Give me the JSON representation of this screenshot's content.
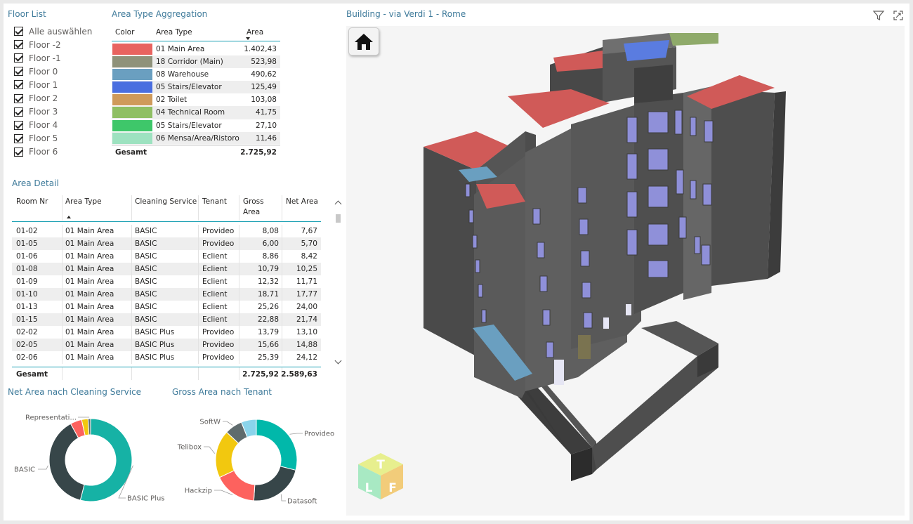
{
  "floor_list": {
    "title": "Floor List",
    "items": [
      {
        "label": "Alle auswählen",
        "checked": true
      },
      {
        "label": "Floor -2",
        "checked": true
      },
      {
        "label": "Floor -1",
        "checked": true
      },
      {
        "label": "Floor 0",
        "checked": true
      },
      {
        "label": "Floor 1",
        "checked": true
      },
      {
        "label": "Floor 2",
        "checked": true
      },
      {
        "label": "Floor 3",
        "checked": true
      },
      {
        "label": "Floor 4",
        "checked": true
      },
      {
        "label": "Floor 5",
        "checked": true
      },
      {
        "label": "Floor 6",
        "checked": true
      }
    ]
  },
  "area_type_aggregation": {
    "title": "Area Type Aggregation",
    "headers": {
      "color": "Color",
      "area_type": "Area Type",
      "area": "Area"
    },
    "rows": [
      {
        "color": "#e8635f",
        "type": "01 Main Area",
        "area": "1.402,43"
      },
      {
        "color": "#8f927a",
        "type": "18 Corridor (Main)",
        "area": "523,98"
      },
      {
        "color": "#6a9fc0",
        "type": "08 Warehouse",
        "area": "490,62"
      },
      {
        "color": "#4a6ee0",
        "type": "05 Stairs/Elevator",
        "area": "125,49"
      },
      {
        "color": "#cf9a5a",
        "type": "02 Toilet",
        "area": "103,08"
      },
      {
        "color": "#8fbf63",
        "type": "04 Technical Room",
        "area": "41,75"
      },
      {
        "color": "#3ec76a",
        "type": "05 Stairs/Elevator",
        "area": "27,10"
      },
      {
        "color": "#9de2c0",
        "type": "06 Mensa/Area/Ristoro",
        "area": "11,46"
      }
    ],
    "total_label": "Gesamt",
    "total_value": "2.725,92"
  },
  "area_detail": {
    "title": "Area Detail",
    "headers": {
      "room": "Room Nr",
      "type": "Area Type",
      "cleaning": "Cleaning Service",
      "tenant": "Tenant",
      "gross": "Gross Area",
      "net": "Net Area"
    },
    "rows": [
      {
        "room": "01-02",
        "type": "01 Main Area",
        "cleaning": "BASIC",
        "tenant": "Provideo",
        "gross": "8,08",
        "net": "7,67"
      },
      {
        "room": "01-05",
        "type": "01 Main Area",
        "cleaning": "BASIC",
        "tenant": "Provideo",
        "gross": "6,00",
        "net": "5,70"
      },
      {
        "room": "01-06",
        "type": "01 Main Area",
        "cleaning": "BASIC",
        "tenant": "Eclient",
        "gross": "8,86",
        "net": "8,42"
      },
      {
        "room": "01-08",
        "type": "01 Main Area",
        "cleaning": "BASIC",
        "tenant": "Eclient",
        "gross": "10,79",
        "net": "10,25"
      },
      {
        "room": "01-09",
        "type": "01 Main Area",
        "cleaning": "BASIC",
        "tenant": "Eclient",
        "gross": "12,32",
        "net": "11,71"
      },
      {
        "room": "01-10",
        "type": "01 Main Area",
        "cleaning": "BASIC",
        "tenant": "Eclient",
        "gross": "18,71",
        "net": "17,77"
      },
      {
        "room": "01-13",
        "type": "01 Main Area",
        "cleaning": "BASIC",
        "tenant": "Eclient",
        "gross": "25,26",
        "net": "24,00"
      },
      {
        "room": "01-15",
        "type": "01 Main Area",
        "cleaning": "BASIC",
        "tenant": "Eclient",
        "gross": "22,88",
        "net": "21,74"
      },
      {
        "room": "02-02",
        "type": "01 Main Area",
        "cleaning": "BASIC Plus",
        "tenant": "Provideo",
        "gross": "13,79",
        "net": "13,10"
      },
      {
        "room": "02-05",
        "type": "01 Main Area",
        "cleaning": "BASIC Plus",
        "tenant": "Provideo",
        "gross": "15,66",
        "net": "14,88"
      },
      {
        "room": "02-06",
        "type": "01 Main Area",
        "cleaning": "BASIC Plus",
        "tenant": "Provideo",
        "gross": "25,39",
        "net": "24,12"
      }
    ],
    "total_label": "Gesamt",
    "total_gross": "2.725,92",
    "total_net": "2.589,63"
  },
  "net_area_by_cleaning": {
    "title": "Net Area nach Cleaning Service",
    "slices": [
      {
        "label": "BASIC Plus",
        "value": 54,
        "color": "#16b2a5"
      },
      {
        "label": "BASIC",
        "value": 38,
        "color": "#374649"
      },
      {
        "label": "",
        "value": 4.5,
        "color": "#fd625e"
      },
      {
        "label": "",
        "value": 2.5,
        "color": "#f2c80f"
      },
      {
        "label": "Representati...",
        "value": 1,
        "color": "#5f6b6d"
      }
    ]
  },
  "gross_area_by_tenant": {
    "title": "Gross Area nach Tenant",
    "slices": [
      {
        "label": "Provideo",
        "value": 29,
        "color": "#01b8aa"
      },
      {
        "label": "Datasoft",
        "value": 22,
        "color": "#374649"
      },
      {
        "label": "Hackzip",
        "value": 17,
        "color": "#fd625e"
      },
      {
        "label": "Telibox",
        "value": 19,
        "color": "#f2c80f"
      },
      {
        "label": "SoftW",
        "value": 7,
        "color": "#5f6b6d"
      },
      {
        "label": "",
        "value": 6,
        "color": "#8ad4eb"
      }
    ]
  },
  "viewer": {
    "title": "Building - via Verdi 1 - Rome",
    "home_icon": "home-icon",
    "filter_icon": "filter-icon",
    "focus_icon": "focus-mode-icon",
    "logo_letters": [
      "T",
      "L",
      "F"
    ]
  }
}
